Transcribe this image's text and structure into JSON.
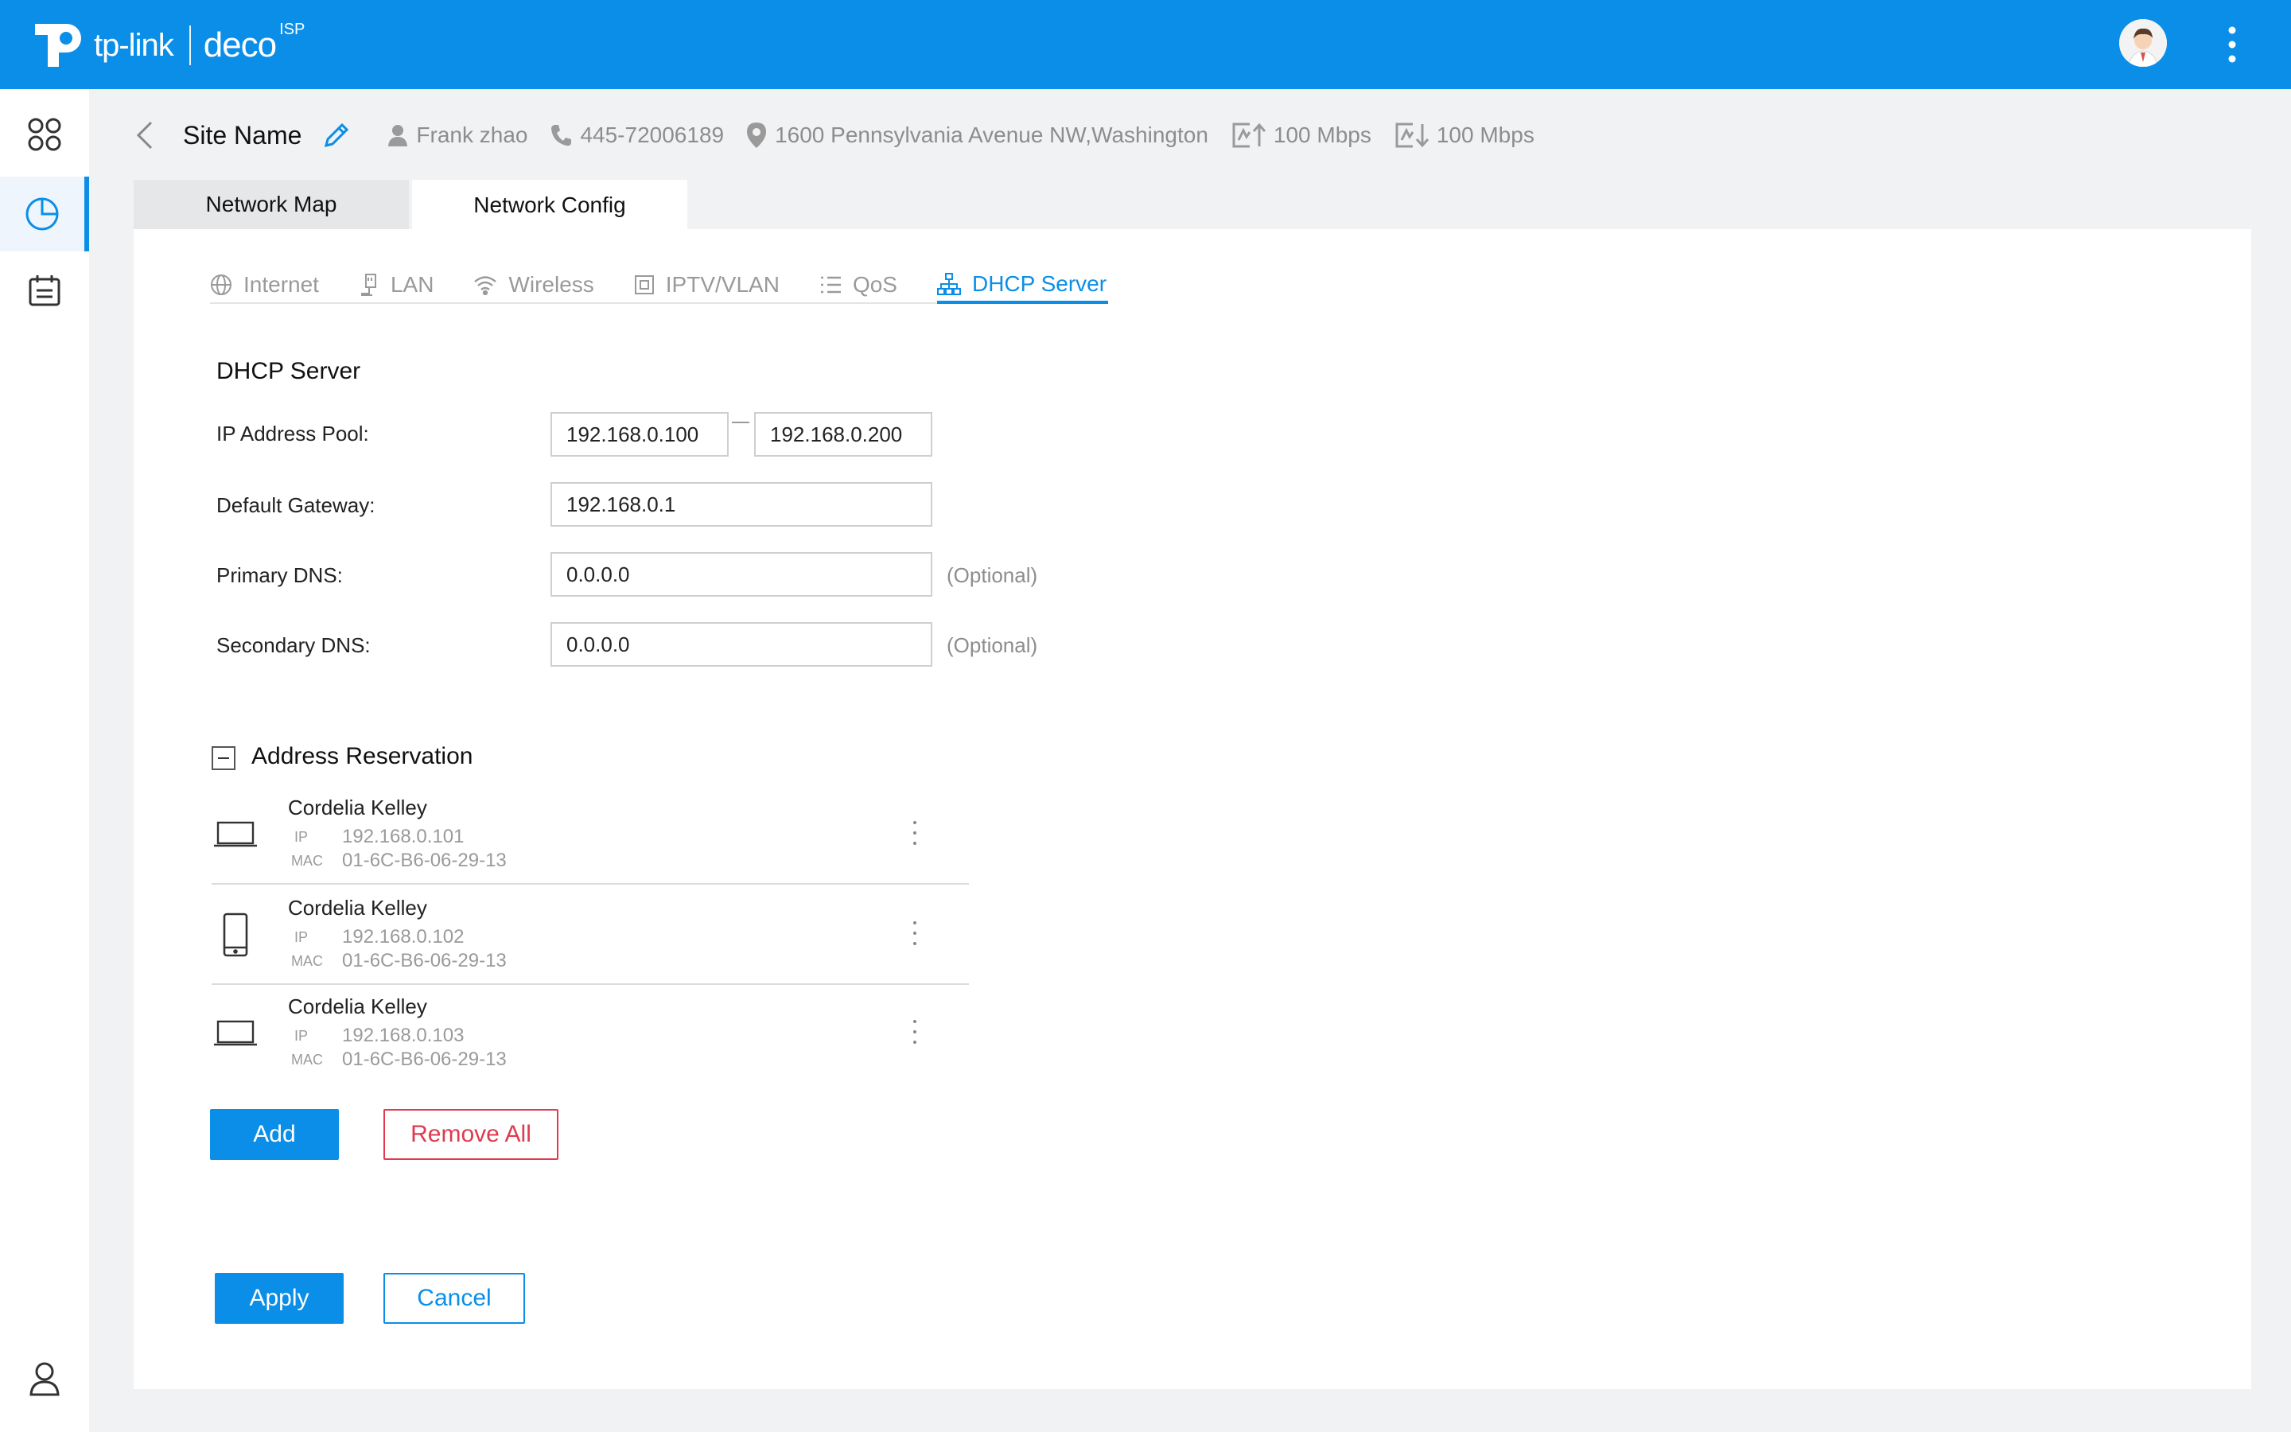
{
  "app": {
    "brand": "tp-link",
    "product": "deco",
    "badge": "ISP"
  },
  "site": {
    "name": "Site Name",
    "owner": "Frank zhao",
    "phone": "445-72006189",
    "address": "1600 Pennsylvania Avenue NW,Washington",
    "upload": "100 Mbps",
    "download": "100 Mbps"
  },
  "tabs": {
    "network_map": "Network Map",
    "network_config": "Network Config"
  },
  "subtabs": [
    "Internet",
    "LAN",
    "Wireless",
    "IPTV/VLAN",
    "QoS",
    "DHCP Server"
  ],
  "dhcp": {
    "title": "DHCP Server",
    "pool_label": "IP Address Pool:",
    "pool_start": "192.168.0.100",
    "pool_end": "192.168.0.200",
    "gateway_label": "Default Gateway:",
    "gateway": "192.168.0.1",
    "primary_dns_label": "Primary DNS:",
    "primary_dns": "0.0.0.0",
    "secondary_dns_label": "Secondary DNS:",
    "secondary_dns": "0.0.0.0",
    "optional": "(Optional)"
  },
  "reservation": {
    "title": "Address Reservation",
    "ip_key": "IP",
    "mac_key": "MAC",
    "items": [
      {
        "name": "Cordelia Kelley",
        "ip": "192.168.0.101",
        "mac": "01-6C-B6-06-29-13",
        "device": "laptop-icon"
      },
      {
        "name": "Cordelia Kelley",
        "ip": "192.168.0.102",
        "mac": "01-6C-B6-06-29-13",
        "device": "phone-icon"
      },
      {
        "name": "Cordelia Kelley",
        "ip": "192.168.0.103",
        "mac": "01-6C-B6-06-29-13",
        "device": "laptop-icon"
      }
    ],
    "add_label": "Add",
    "remove_all_label": "Remove All"
  },
  "actions": {
    "apply": "Apply",
    "cancel": "Cancel"
  },
  "colors": {
    "primary": "#0a8ee8",
    "danger": "#e03a4e",
    "background": "#f1f2f4"
  }
}
